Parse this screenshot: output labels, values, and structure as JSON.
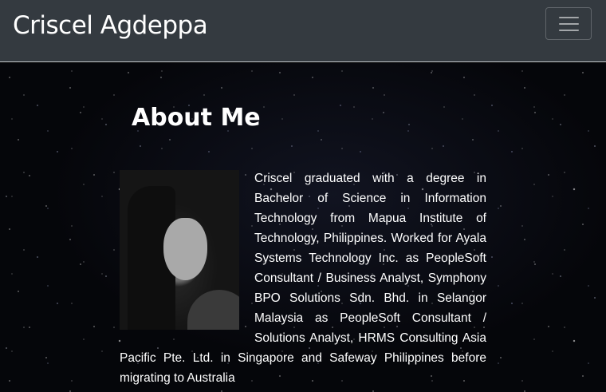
{
  "navbar": {
    "brand": "Criscel Agdeppa",
    "toggler_icon": "hamburger-menu-icon"
  },
  "about": {
    "title": "About Me",
    "photo_alt": "profile-photo",
    "text": "Criscel graduated with a degree in Bachelor of Science in Information Technology from Mapua Institute of Technology, Philippines. Worked for Ayala Systems Technology Inc. as PeopleSoft Consultant / Business Analyst, Symphony BPO Solutions Sdn. Bhd. in Selangor Malaysia as PeopleSoft Consultant / Solutions Analyst, HRMS Consulting Asia Pacific Pte. Ltd. in Singapore and Safeway Philippines before migrating to Australia"
  },
  "colors": {
    "navbar_bg": "#343a40",
    "page_bg": "#05060a",
    "text": "#ffffff"
  }
}
